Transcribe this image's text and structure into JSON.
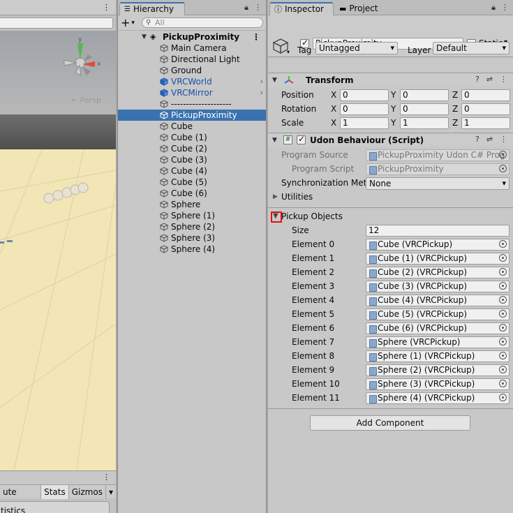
{
  "scene": {
    "persp_label": "← Persp",
    "toolbar": [
      "ute Audio",
      "Stats",
      "Gizmos"
    ],
    "stats_panel_label": "tistics",
    "gizmo_axis_y": "y",
    "gizmo_axis_x": "x"
  },
  "hierarchy": {
    "tab_label": "Hierarchy",
    "search_placeholder": "All",
    "add_label": "+",
    "scene_name": "PickupProximity",
    "items": [
      {
        "label": "Main Camera",
        "type": "normal"
      },
      {
        "label": "Directional Light",
        "type": "normal"
      },
      {
        "label": "Ground",
        "type": "normal"
      },
      {
        "label": "VRCWorld",
        "type": "prefab"
      },
      {
        "label": "VRCMirror",
        "type": "prefab"
      },
      {
        "label": "--------------------",
        "type": "normal"
      },
      {
        "label": "PickupProximity",
        "type": "selected"
      },
      {
        "label": "Cube",
        "type": "normal"
      },
      {
        "label": "Cube (1)",
        "type": "normal"
      },
      {
        "label": "Cube (2)",
        "type": "normal"
      },
      {
        "label": "Cube (3)",
        "type": "normal"
      },
      {
        "label": "Cube (4)",
        "type": "normal"
      },
      {
        "label": "Cube (5)",
        "type": "normal"
      },
      {
        "label": "Cube (6)",
        "type": "normal"
      },
      {
        "label": "Sphere",
        "type": "normal"
      },
      {
        "label": "Sphere (1)",
        "type": "normal"
      },
      {
        "label": "Sphere (2)",
        "type": "normal"
      },
      {
        "label": "Sphere (3)",
        "type": "normal"
      },
      {
        "label": "Sphere (4)",
        "type": "normal"
      }
    ]
  },
  "inspector": {
    "tab_inspector": "Inspector",
    "tab_project": "Project",
    "object_name": "PickupProximity",
    "static_label": "Static",
    "tag_label": "Tag",
    "tag_value": "Untagged",
    "layer_label": "Layer",
    "layer_value": "Default",
    "transform": {
      "title": "Transform",
      "rows": [
        {
          "label": "Position",
          "x": "0",
          "y": "0",
          "z": "0"
        },
        {
          "label": "Rotation",
          "x": "0",
          "y": "0",
          "z": "0"
        },
        {
          "label": "Scale",
          "x": "1",
          "y": "1",
          "z": "1"
        }
      ],
      "axis_x": "X",
      "axis_y": "Y",
      "axis_z": "Z"
    },
    "udon": {
      "title": "Udon Behaviour (Script)",
      "program_source_label": "Program Source",
      "program_source_value": "PickupProximity Udon C# Prog",
      "program_script_label": "Program Script",
      "program_script_value": "PickupProximity",
      "sync_label": "Synchronization Metl",
      "sync_value": "None",
      "utilities_label": "Utilities",
      "pickup_label": "Pickup Objects",
      "size_label": "Size",
      "size_value": "12",
      "elements": [
        {
          "label": "Element 0",
          "value": "Cube (VRCPickup)"
        },
        {
          "label": "Element 1",
          "value": "Cube (1) (VRCPickup)"
        },
        {
          "label": "Element 2",
          "value": "Cube (2) (VRCPickup)"
        },
        {
          "label": "Element 3",
          "value": "Cube (3) (VRCPickup)"
        },
        {
          "label": "Element 4",
          "value": "Cube (4) (VRCPickup)"
        },
        {
          "label": "Element 5",
          "value": "Cube (5) (VRCPickup)"
        },
        {
          "label": "Element 6",
          "value": "Cube (6) (VRCPickup)"
        },
        {
          "label": "Element 7",
          "value": "Sphere (VRCPickup)"
        },
        {
          "label": "Element 8",
          "value": "Sphere (1) (VRCPickup)"
        },
        {
          "label": "Element 9",
          "value": "Sphere (2) (VRCPickup)"
        },
        {
          "label": "Element 10",
          "value": "Sphere (3) (VRCPickup)"
        },
        {
          "label": "Element 11",
          "value": "Sphere (4) (VRCPickup)"
        }
      ]
    },
    "add_component_label": "Add Component"
  },
  "colors": {
    "selection": "#3a72b0",
    "highlight": "#e01010",
    "prefab_text": "#1a50a8"
  }
}
